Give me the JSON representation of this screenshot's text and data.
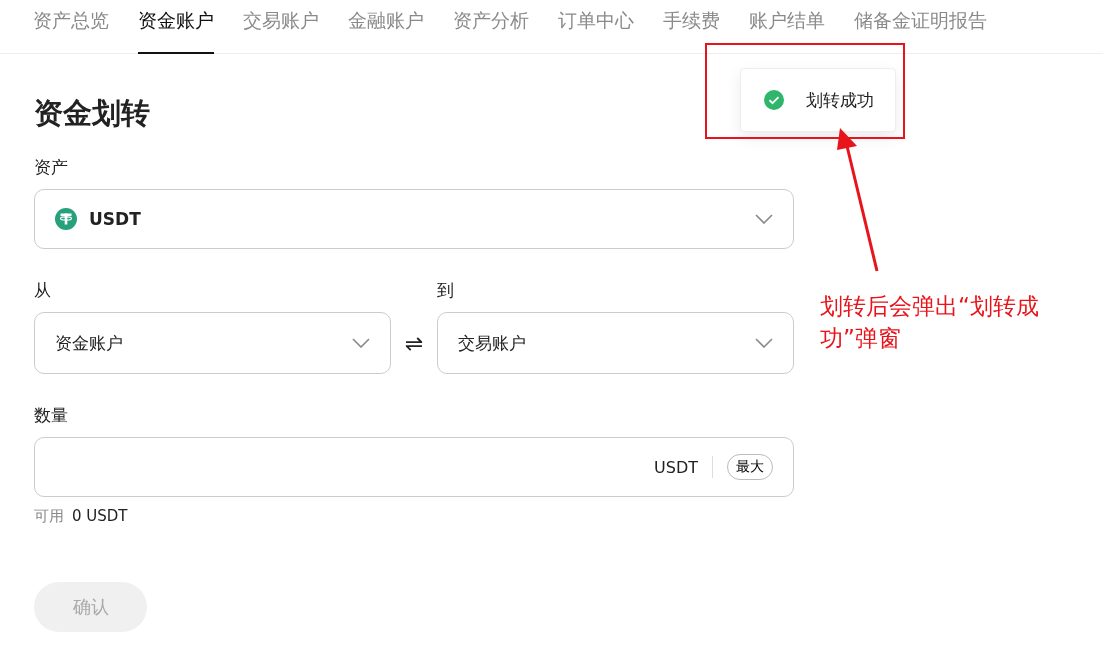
{
  "tabs": [
    {
      "label": "资产总览",
      "selected": false
    },
    {
      "label": "资金账户",
      "selected": true
    },
    {
      "label": "交易账户",
      "selected": false
    },
    {
      "label": "金融账户",
      "selected": false
    },
    {
      "label": "资产分析",
      "selected": false
    },
    {
      "label": "订单中心",
      "selected": false
    },
    {
      "label": "手续费",
      "selected": false
    },
    {
      "label": "账户结单",
      "selected": false
    },
    {
      "label": "储备金证明报告",
      "selected": false
    }
  ],
  "form": {
    "title": "资金划转",
    "asset": {
      "label": "资产",
      "value": "USDT"
    },
    "from": {
      "label": "从",
      "value": "资金账户"
    },
    "swap": "⇌",
    "to": {
      "label": "到",
      "value": "交易账户"
    },
    "amount": {
      "label": "数量",
      "unit": "USDT",
      "max_button": "最大"
    },
    "available": {
      "label": "可用",
      "value": "0 USDT"
    },
    "confirm": {
      "label": "确认",
      "disabled": true
    }
  },
  "toast": {
    "text": "划转成功"
  },
  "annotation": {
    "text": "划转后会弹出“划转成功”弹窗"
  }
}
